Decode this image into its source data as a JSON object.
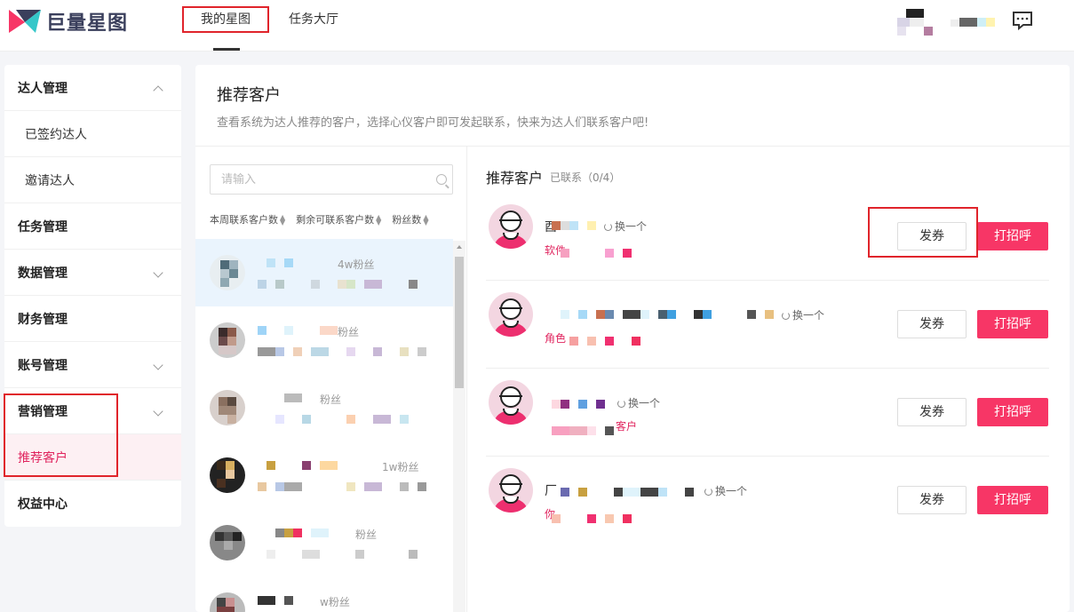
{
  "header": {
    "logo_text": "巨量星图",
    "tabs": [
      {
        "label": "我的星图",
        "active": true
      },
      {
        "label": "任务大厅",
        "active": false
      }
    ],
    "chat_icon": "chat-bubble-icon"
  },
  "sidebar": {
    "items": [
      {
        "label": "达人管理",
        "expanded": true
      },
      {
        "label": "已签约达人",
        "sub": true
      },
      {
        "label": "邀请达人",
        "sub": true
      },
      {
        "label": "任务管理"
      },
      {
        "label": "数据管理"
      },
      {
        "label": "财务管理"
      },
      {
        "label": "账号管理"
      },
      {
        "label": "营销管理",
        "expanded": true
      },
      {
        "label": "推荐客户",
        "sub": true,
        "selected": true
      },
      {
        "label": "权益中心"
      }
    ]
  },
  "main": {
    "title": "推荐客户",
    "description": "查看系统为达人推荐的客户，选择心仪客户即可发起联系，快来为达人们联系客户吧!",
    "search": {
      "placeholder": "请输入"
    },
    "sort_columns": [
      "本周联系客户数",
      "剩余可联系客户数",
      "粉丝数"
    ],
    "list_items": [
      {
        "fans": "4w粉丝"
      },
      {
        "fans": "粉丝"
      },
      {
        "fans": "粉丝"
      },
      {
        "fans": "1w粉丝"
      },
      {
        "fans": "粉丝"
      },
      {
        "fans": "w粉丝"
      }
    ],
    "customers": {
      "header": "推荐客户",
      "contacted": "已联系（0/4）",
      "swap_label": "换一个",
      "coupon_label": "发券",
      "greet_label": "打招呼",
      "rows": [
        {
          "name_prefix": "酉",
          "tag": "软件"
        },
        {
          "name_prefix": "",
          "tag": "角色"
        },
        {
          "name_prefix": "",
          "tag": "客户"
        },
        {
          "name_prefix": "厂",
          "tag": "你"
        }
      ]
    }
  },
  "colors": {
    "accent": "#f73666",
    "highlight": "#e0242b",
    "selected_bg": "#fdf0f3"
  }
}
